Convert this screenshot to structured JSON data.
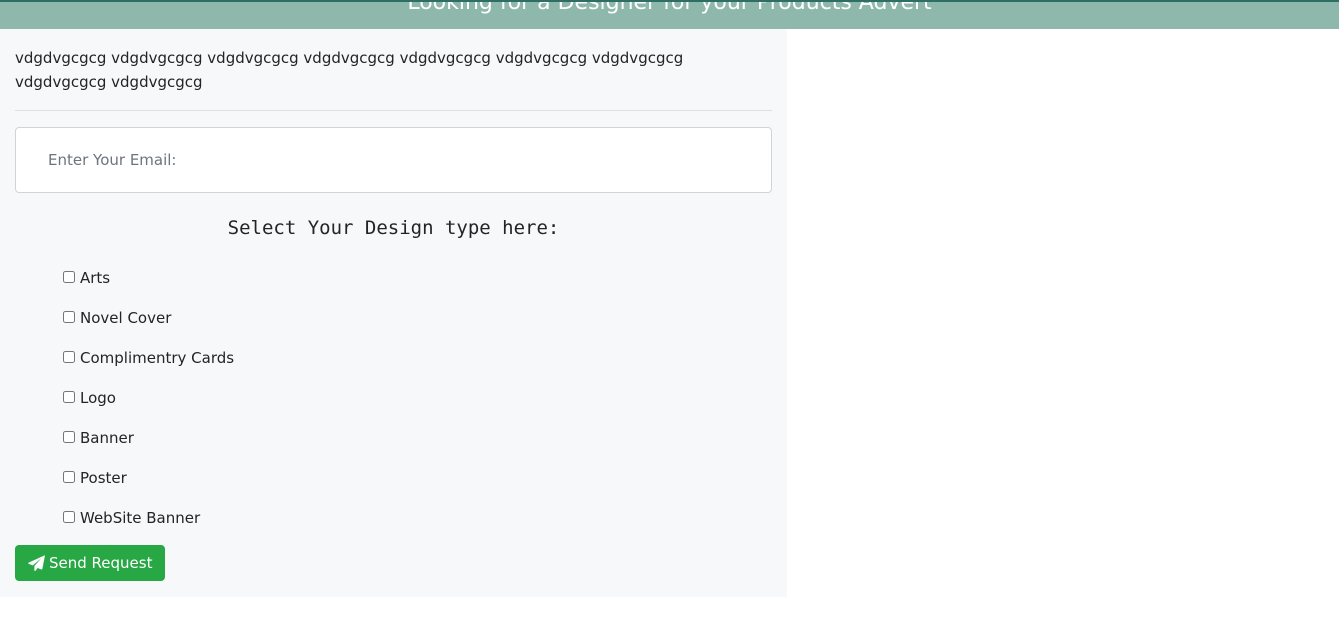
{
  "header": {
    "title": "Looking for a Designer for your Products Advert"
  },
  "intro_text": "vdgdvgcgcg vdgdvgcgcg vdgdvgcgcg vdgdvgcgcg vdgdvgcgcg vdgdvgcgcg vdgdvgcgcg vdgdvgcgcg vdgdvgcgcg",
  "email": {
    "placeholder": "Enter Your Email:",
    "value": ""
  },
  "design_section": {
    "heading": "Select Your Design type here:",
    "options": [
      {
        "label": "Arts",
        "checked": false
      },
      {
        "label": "Novel Cover",
        "checked": false
      },
      {
        "label": "Complimentry Cards",
        "checked": false
      },
      {
        "label": "Logo",
        "checked": false
      },
      {
        "label": "Banner",
        "checked": false
      },
      {
        "label": "Poster",
        "checked": false
      },
      {
        "label": "WebSite Banner",
        "checked": false
      }
    ]
  },
  "submit": {
    "label": "Send Request",
    "icon": "paper-plane-icon"
  },
  "colors": {
    "header_bg": "#8fb8ad",
    "panel_bg": "#f7f8fa",
    "button_bg": "#28a745"
  }
}
